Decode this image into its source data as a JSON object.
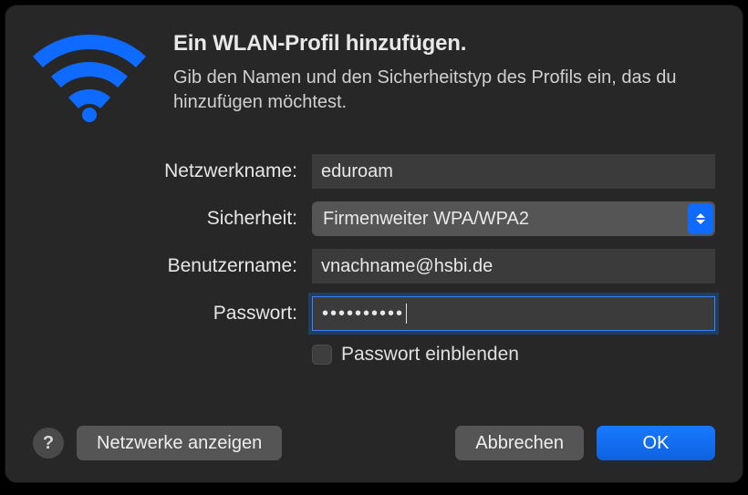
{
  "colors": {
    "accent": "#0f6bff",
    "bg": "#272727",
    "input_bg": "#3b3b3b",
    "input_focus_ring": "#3b82f6"
  },
  "header": {
    "title": "Ein WLAN-Profil hinzufügen.",
    "subtitle": "Gib den Namen und den Sicherheitstyp des Profils ein, das du hinzufügen möchtest."
  },
  "form": {
    "network_name": {
      "label": "Netzwerkname:",
      "value": "eduroam"
    },
    "security": {
      "label": "Sicherheit:",
      "value": "Firmenweiter WPA/WPA2"
    },
    "username": {
      "label": "Benutzername:",
      "value": "vnachname@hsbi.de"
    },
    "password": {
      "label": "Passwort:",
      "mask": "••••••••••"
    },
    "show_password": {
      "label": "Passwort einblenden",
      "checked": false
    }
  },
  "footer": {
    "help": "?",
    "show_networks": "Netzwerke anzeigen",
    "cancel": "Abbrechen",
    "ok": "OK"
  }
}
